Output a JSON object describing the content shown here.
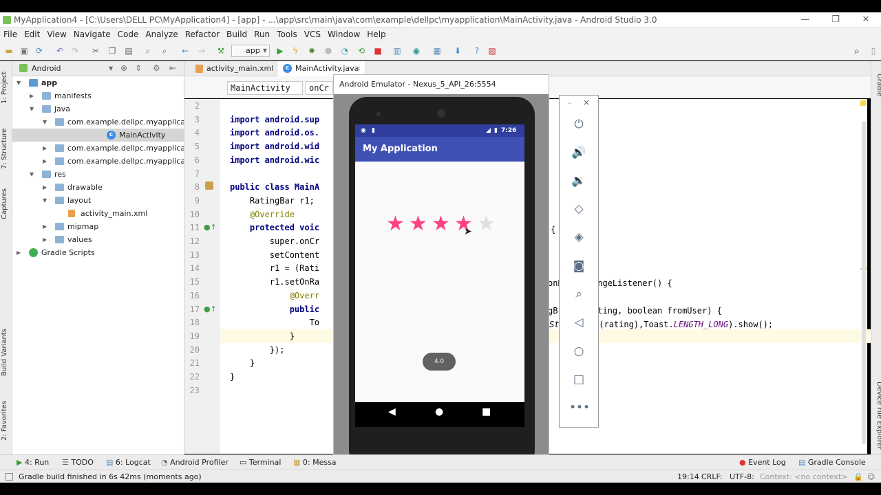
{
  "window": {
    "title": "MyApplication4 - [C:\\Users\\DELL PC\\MyApplication4] - [app] - ...\\app\\src\\main\\java\\com\\example\\dellpc\\myapplication\\MainActivity.java - Android Studio 3.0"
  },
  "menu": [
    "File",
    "Edit",
    "View",
    "Navigate",
    "Code",
    "Analyze",
    "Refactor",
    "Build",
    "Run",
    "Tools",
    "VCS",
    "Window",
    "Help"
  ],
  "toolbar": {
    "run_config": "app"
  },
  "project_panel": {
    "view_selector": "Android",
    "tree": [
      {
        "label": "app",
        "depth": 0,
        "expanded": true,
        "kind": "module"
      },
      {
        "label": "manifests",
        "depth": 1,
        "expanded": false,
        "kind": "folder"
      },
      {
        "label": "java",
        "depth": 1,
        "expanded": true,
        "kind": "folder"
      },
      {
        "label": "com.example.dellpc.myapplication",
        "depth": 2,
        "expanded": true,
        "kind": "package"
      },
      {
        "label": "MainActivity",
        "depth": 3,
        "expanded": null,
        "kind": "class",
        "selected": true
      },
      {
        "label": "com.example.dellpc.myapplication",
        "depth": 2,
        "expanded": false,
        "kind": "package"
      },
      {
        "label": "com.example.dellpc.myapplication",
        "depth": 2,
        "expanded": false,
        "kind": "package"
      },
      {
        "label": "res",
        "depth": 1,
        "expanded": true,
        "kind": "folder"
      },
      {
        "label": "drawable",
        "depth": 2,
        "expanded": false,
        "kind": "folder"
      },
      {
        "label": "layout",
        "depth": 2,
        "expanded": true,
        "kind": "folder"
      },
      {
        "label": "activity_main.xml",
        "depth": 3,
        "expanded": null,
        "kind": "xml"
      },
      {
        "label": "mipmap",
        "depth": 2,
        "expanded": false,
        "kind": "folder"
      },
      {
        "label": "values",
        "depth": 2,
        "expanded": false,
        "kind": "folder"
      },
      {
        "label": "Gradle Scripts",
        "depth": 0,
        "expanded": false,
        "kind": "gradle"
      }
    ]
  },
  "left_tool_tabs": [
    "1: Project",
    "7: Structure",
    "Captures",
    "Build Variants",
    "2: Favorites"
  ],
  "right_tool_tabs": [
    "Gradle",
    "Device File Explorer"
  ],
  "editor": {
    "tabs": [
      "activity_main.xml",
      "MainActivity.java"
    ],
    "active_tab": "MainActivity.java",
    "breadcrumbs": [
      "MainActivity",
      "onCr"
    ],
    "line_numbers": [
      "2",
      "3",
      "4",
      "5",
      "6",
      "7",
      "8",
      "9",
      "10",
      "11",
      "12",
      "13",
      "14",
      "15",
      "16",
      "17",
      "18",
      "19",
      "20",
      "21",
      "22",
      "23"
    ],
    "code_left": [
      "",
      "import android.sup",
      "import android.os.",
      "import android.wid",
      "import android.wic",
      "",
      "public class MainA",
      "    RatingBar r1;",
      "    @Override",
      "    protected voic",
      "        super.onCr",
      "        setContent",
      "        r1 = (Rati",
      "        r1.setOnRa",
      "            @Overr",
      "            public",
      "                To",
      "            }",
      "        });",
      "    }",
      "}",
      ""
    ],
    "code_right": {
      "line11": "{",
      "line15": "onR  arChangeListener() {",
      "line17": "gB  oat rating, boolean fromUser) {",
      "line18_a": "St  alueOf",
      "line18_b": "(rating),Toast.",
      "line18_c": "LENGTH_LONG",
      "line18_d": ").show();"
    }
  },
  "emulator": {
    "title": "Android Emulator - Nexus_5_API_26:5554",
    "status_time": "7:26",
    "app_title": "My Application",
    "rating": 4,
    "num_stars": 5,
    "toast_text": "4.0",
    "side_panel": [
      "power-icon",
      "volume-up-icon",
      "volume-down-icon",
      "rotate-left-icon",
      "rotate-right-icon",
      "camera-icon",
      "zoom-icon",
      "back-icon",
      "home-icon",
      "overview-icon",
      "more-icon"
    ]
  },
  "bottom_tabs": [
    "4: Run",
    "TODO",
    "6: Logcat",
    "Android Profiler",
    "Terminal",
    "0: Messa",
    "Event Log",
    "Gradle Console"
  ],
  "status": {
    "message": "Gradle build finished in 6s 42ms (moments ago)",
    "position": "19:14",
    "line_sep": "CRLF:",
    "encoding": "UTF-8:",
    "context": "Context: <no context>"
  },
  "colors": {
    "accent": "#3f51b5",
    "status": "#303f9f",
    "star": "#ff4081"
  }
}
